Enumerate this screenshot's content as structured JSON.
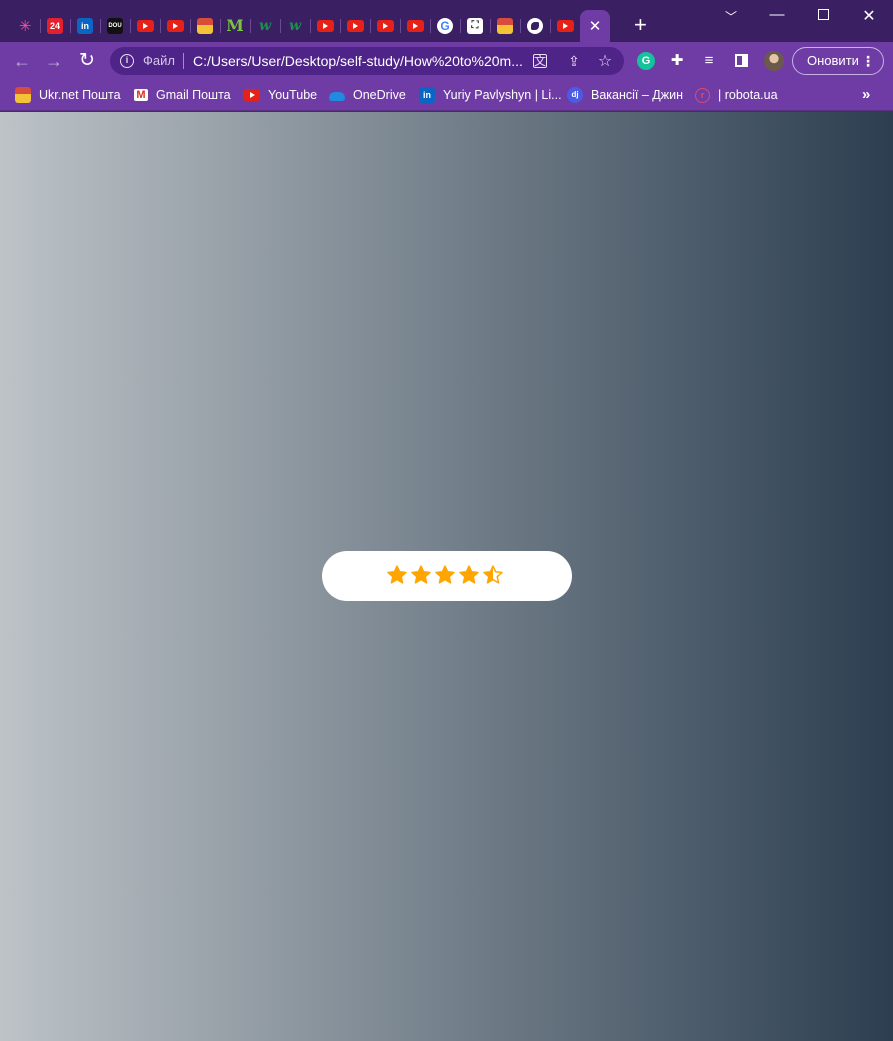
{
  "tabs": [
    {
      "icon": "pinwheel-icon"
    },
    {
      "icon": "news24-icon",
      "favicon_text": "24"
    },
    {
      "icon": "linkedin-icon",
      "favicon_text": "in"
    },
    {
      "icon": "dou-icon",
      "favicon_text": "DOU"
    },
    {
      "icon": "youtube-icon"
    },
    {
      "icon": "youtube-icon"
    },
    {
      "icon": "ukrnet-icon"
    },
    {
      "icon": "monobank-icon",
      "favicon_text": "M"
    },
    {
      "icon": "w-icon",
      "favicon_text": "w"
    },
    {
      "icon": "w-icon",
      "favicon_text": "w"
    },
    {
      "icon": "youtube-icon"
    },
    {
      "icon": "youtube-icon"
    },
    {
      "icon": "youtube-icon"
    },
    {
      "icon": "youtube-icon"
    },
    {
      "icon": "google-icon",
      "favicon_text": "G"
    },
    {
      "icon": "photo-icon"
    },
    {
      "icon": "ukrnet-icon"
    },
    {
      "icon": "globe-icon"
    },
    {
      "icon": "youtube-icon"
    },
    {
      "icon": "close-icon",
      "active": true
    }
  ],
  "toolbar": {
    "file_label": "Файл",
    "url": "C:/Users/User/Desktop/self-study/How%20to%20m...",
    "update_label": "Оновити"
  },
  "bookmarks": [
    {
      "label": "Ukr.net Пошта",
      "icon": "ukrnet-icon"
    },
    {
      "label": "Gmail Пошта",
      "icon": "gmail-icon"
    },
    {
      "label": "YouTube",
      "icon": "youtube-icon"
    },
    {
      "label": "OneDrive",
      "icon": "onedrive-icon"
    },
    {
      "label": "Yuriy Pavlyshyn | Li...",
      "icon": "linkedin-icon"
    },
    {
      "label": "Вакансії – Джин",
      "icon": "djinni-icon"
    },
    {
      "label": "| robota.ua",
      "icon": "robota-icon"
    }
  ],
  "page": {
    "gradient_start": "#bdc3c7",
    "gradient_end": "#2c3e50",
    "rating": {
      "value": 4.5,
      "max": 5,
      "star_color": "#ffa502"
    }
  }
}
